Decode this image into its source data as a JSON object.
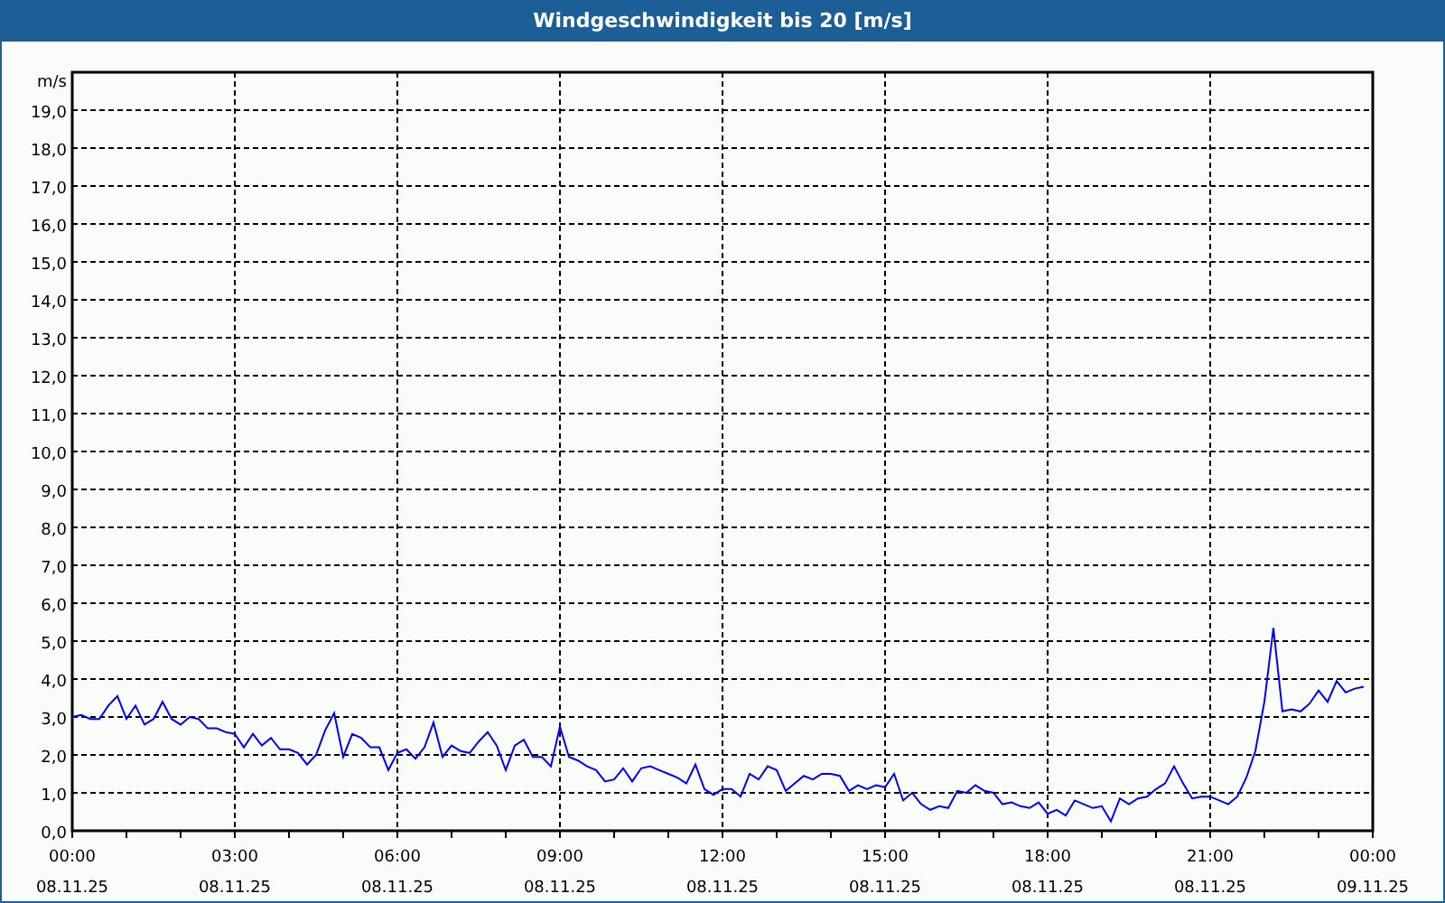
{
  "window": {
    "title": "Windgeschwindigkeit bis 20 [m/s]"
  },
  "chart": {
    "date_labels": [
      "08.11.25",
      "08.11.25",
      "08.11.25",
      "08.11.25",
      "08.11.25",
      "08.11.25",
      "08.11.25",
      "08.11.25",
      "09.11.25"
    ],
    "chart_data": {
      "type": "line",
      "ylabel": "m/s",
      "xlim": [
        0,
        24
      ],
      "ylim": [
        0,
        20
      ],
      "xticks": [
        {
          "value": 0,
          "label": "00:00"
        },
        {
          "value": 3,
          "label": "03:00"
        },
        {
          "value": 6,
          "label": "06:00"
        },
        {
          "value": 9,
          "label": "09:00"
        },
        {
          "value": 12,
          "label": "12:00"
        },
        {
          "value": 15,
          "label": "15:00"
        },
        {
          "value": 18,
          "label": "18:00"
        },
        {
          "value": 21,
          "label": "21:00"
        },
        {
          "value": 24,
          "label": "00:00"
        }
      ],
      "yticks": [
        {
          "value": 0,
          "label": "0,0"
        },
        {
          "value": 1,
          "label": "1,0"
        },
        {
          "value": 2,
          "label": "2,0"
        },
        {
          "value": 3,
          "label": "3,0"
        },
        {
          "value": 4,
          "label": "4,0"
        },
        {
          "value": 5,
          "label": "5,0"
        },
        {
          "value": 6,
          "label": "6,0"
        },
        {
          "value": 7,
          "label": "7,0"
        },
        {
          "value": 8,
          "label": "8,0"
        },
        {
          "value": 9,
          "label": "9,0"
        },
        {
          "value": 10,
          "label": "10,0"
        },
        {
          "value": 11,
          "label": "11,0"
        },
        {
          "value": 12,
          "label": "12,0"
        },
        {
          "value": 13,
          "label": "13,0"
        },
        {
          "value": 14,
          "label": "14,0"
        },
        {
          "value": 15,
          "label": "15,0"
        },
        {
          "value": 16,
          "label": "16,0"
        },
        {
          "value": 17,
          "label": "17,0"
        },
        {
          "value": 18,
          "label": "18,0"
        },
        {
          "value": 19,
          "label": "19,0"
        }
      ],
      "grid": true,
      "x": [
        0,
        0.167,
        0.333,
        0.5,
        0.667,
        0.833,
        1,
        1.167,
        1.333,
        1.5,
        1.667,
        1.833,
        2,
        2.167,
        2.333,
        2.5,
        2.667,
        2.833,
        3,
        3.167,
        3.333,
        3.5,
        3.667,
        3.833,
        4,
        4.167,
        4.333,
        4.5,
        4.667,
        4.833,
        5,
        5.167,
        5.333,
        5.5,
        5.667,
        5.833,
        6,
        6.167,
        6.333,
        6.5,
        6.667,
        6.833,
        7,
        7.167,
        7.333,
        7.5,
        7.667,
        7.833,
        8,
        8.167,
        8.333,
        8.5,
        8.667,
        8.833,
        9,
        9.167,
        9.333,
        9.5,
        9.667,
        9.833,
        10,
        10.167,
        10.333,
        10.5,
        10.667,
        10.833,
        11,
        11.167,
        11.333,
        11.5,
        11.667,
        11.833,
        12,
        12.167,
        12.333,
        12.5,
        12.667,
        12.833,
        13,
        13.167,
        13.333,
        13.5,
        13.667,
        13.833,
        14,
        14.167,
        14.333,
        14.5,
        14.667,
        14.833,
        15,
        15.167,
        15.333,
        15.5,
        15.667,
        15.833,
        16,
        16.167,
        16.333,
        16.5,
        16.667,
        16.833,
        17,
        17.167,
        17.333,
        17.5,
        17.667,
        17.833,
        18,
        18.167,
        18.333,
        18.5,
        18.667,
        18.833,
        19,
        19.167,
        19.333,
        19.5,
        19.667,
        19.833,
        20,
        20.167,
        20.333,
        20.5,
        20.667,
        20.833,
        21,
        21.167,
        21.333,
        21.5,
        21.667,
        21.833,
        22,
        22.167,
        22.333,
        22.5,
        22.667,
        22.833,
        23,
        23.167,
        23.333,
        23.5,
        23.667,
        23.833
      ],
      "series": [
        {
          "color": "#0000ff",
          "values": [
            3.0,
            3.05,
            2.95,
            2.95,
            3.3,
            3.55,
            2.95,
            3.3,
            2.8,
            2.95,
            3.4,
            2.95,
            2.8,
            3.0,
            2.95,
            2.7,
            2.7,
            2.6,
            2.55,
            2.2,
            2.55,
            2.25,
            2.45,
            2.15,
            2.15,
            2.05,
            1.75,
            2.0,
            2.65,
            3.1,
            1.95,
            2.55,
            2.45,
            2.2,
            2.2,
            1.6,
            2.05,
            2.15,
            1.9,
            2.2,
            2.85,
            1.95,
            2.25,
            2.1,
            2.05,
            2.35,
            2.6,
            2.25,
            1.6,
            2.25,
            2.4,
            1.95,
            1.95,
            1.7,
            2.75,
            1.95,
            1.85,
            1.7,
            1.6,
            1.3,
            1.35,
            1.65,
            1.3,
            1.65,
            1.7,
            1.6,
            1.5,
            1.4,
            1.25,
            1.75,
            1.1,
            0.95,
            1.1,
            1.1,
            0.9,
            1.5,
            1.35,
            1.7,
            1.6,
            1.05,
            1.25,
            1.45,
            1.35,
            1.5,
            1.5,
            1.45,
            1.05,
            1.2,
            1.1,
            1.2,
            1.15,
            1.5,
            0.8,
            1.0,
            0.7,
            0.55,
            0.65,
            0.6,
            1.05,
            1.0,
            1.2,
            1.05,
            1.0,
            0.7,
            0.75,
            0.65,
            0.6,
            0.75,
            0.45,
            0.55,
            0.4,
            0.8,
            0.7,
            0.6,
            0.65,
            0.25,
            0.85,
            0.7,
            0.85,
            0.9,
            1.1,
            1.25,
            1.7,
            1.25,
            0.85,
            0.9,
            0.9,
            0.8,
            0.7,
            0.9,
            1.4,
            2.1,
            3.4,
            5.35,
            3.15,
            3.2,
            3.15,
            3.35,
            3.7,
            3.4,
            3.95,
            3.65,
            3.75,
            3.8
          ]
        }
      ]
    }
  }
}
